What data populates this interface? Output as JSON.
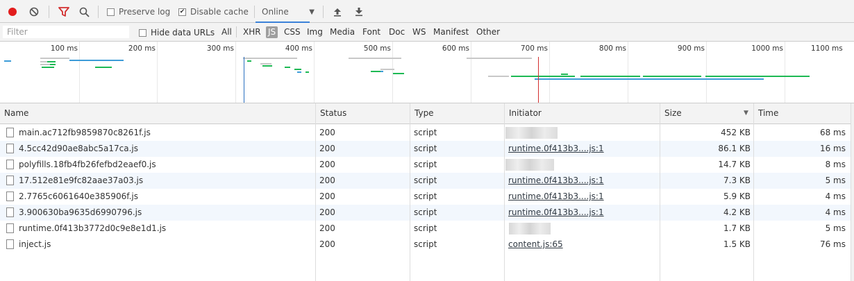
{
  "toolbar": {
    "preserve_log_label": "Preserve log",
    "preserve_log_checked": false,
    "disable_cache_label": "Disable cache",
    "disable_cache_checked": true,
    "throttle_value": "Online"
  },
  "filterbar": {
    "filter_placeholder": "Filter",
    "hide_data_urls_label": "Hide data URLs",
    "types": [
      "All",
      "XHR",
      "JS",
      "CSS",
      "Img",
      "Media",
      "Font",
      "Doc",
      "WS",
      "Manifest",
      "Other"
    ],
    "active_type": "JS"
  },
  "overview": {
    "ticks": [
      "100 ms",
      "200 ms",
      "300 ms",
      "400 ms",
      "500 ms",
      "600 ms",
      "700 ms",
      "800 ms",
      "900 ms",
      "1000 ms",
      "1100 ms"
    ]
  },
  "table": {
    "columns": [
      "Name",
      "Status",
      "Type",
      "Initiator",
      "Size",
      "Time"
    ],
    "rows": [
      {
        "name": "main.ac712fb9859870c8261f.js",
        "status": "200",
        "type": "script",
        "initiator": "",
        "size": "452 KB",
        "time": "68 ms"
      },
      {
        "name": "4.5cc42d90ae8abc5a17ca.js",
        "status": "200",
        "type": "script",
        "initiator": "runtime.0f413b3....js:1",
        "size": "86.1 KB",
        "time": "16 ms"
      },
      {
        "name": "polyfills.18fb4fb26fefbd2eaef0.js",
        "status": "200",
        "type": "script",
        "initiator": "",
        "size": "14.7 KB",
        "time": "8 ms"
      },
      {
        "name": "17.512e81e9fc82aae37a03.js",
        "status": "200",
        "type": "script",
        "initiator": "runtime.0f413b3....js:1",
        "size": "7.3 KB",
        "time": "5 ms"
      },
      {
        "name": "2.7765c6061640e385906f.js",
        "status": "200",
        "type": "script",
        "initiator": "runtime.0f413b3....js:1",
        "size": "5.9 KB",
        "time": "4 ms"
      },
      {
        "name": "3.900630ba9635d6990796.js",
        "status": "200",
        "type": "script",
        "initiator": "runtime.0f413b3....js:1",
        "size": "4.2 KB",
        "time": "4 ms"
      },
      {
        "name": "runtime.0f413b3772d0c9e8e1d1.js",
        "status": "200",
        "type": "script",
        "initiator": "",
        "size": "1.7 KB",
        "time": "5 ms"
      },
      {
        "name": "inject.js",
        "status": "200",
        "type": "script",
        "initiator": "content.js:65",
        "size": "1.5 KB",
        "time": "76 ms"
      }
    ]
  },
  "colors": {
    "record": "#e21d1d",
    "filter_icon": "#d32f2f",
    "bar_green": "#1db954",
    "bar_blue": "#3d9cd8",
    "bar_gray": "#c8c8c8",
    "load_line": "#d32f2f",
    "dcl_line": "#2a6fc0"
  }
}
